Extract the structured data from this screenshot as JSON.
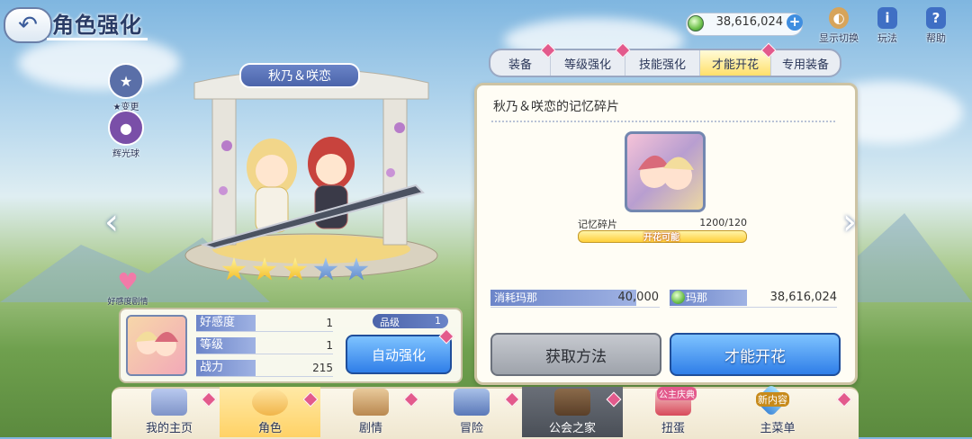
{
  "header": {
    "title": "角色强化",
    "back_icon": "back-arrow-icon",
    "mana": "38,616,024",
    "top_buttons": [
      {
        "label": "显示切换",
        "icon": "display-switch-icon"
      },
      {
        "label": "玩法",
        "icon": "info-icon"
      },
      {
        "label": "帮助",
        "icon": "help-icon"
      }
    ]
  },
  "tabs": [
    {
      "label": "装备"
    },
    {
      "label": "等级强化"
    },
    {
      "label": "技能强化"
    },
    {
      "label": "才能开花"
    },
    {
      "label": "专用装备"
    }
  ],
  "active_tab": "才能开花",
  "character": {
    "name": "秋乃＆咲恋",
    "stars_on": 3,
    "stars_total": 5,
    "side_buttons": [
      {
        "label": "★变更",
        "icon": "star-change-icon"
      },
      {
        "label": "辉光球",
        "icon": "glow-orb-icon"
      }
    ],
    "affection_label": "好感度剧情"
  },
  "stats": {
    "rows": [
      {
        "label": "好感度",
        "value": "1"
      },
      {
        "label": "等级",
        "value": "1"
      },
      {
        "label": "战力",
        "value": "215"
      }
    ],
    "rank_label": "品级",
    "rank_value": "1",
    "auto_button": "自动强化"
  },
  "panel": {
    "title": "秋乃＆咲恋的记忆碎片",
    "shard_label": "记忆碎片",
    "shard_count": "1200/120",
    "bar_text": "开花可能",
    "progress": 1.0,
    "cost_label": "消耗玛那",
    "cost_value": "40,000",
    "mana_label": "玛那",
    "mana_value": "38,616,024",
    "obtain_button": "获取方法",
    "bloom_button": "才能开花"
  },
  "nav": [
    {
      "label": "我的主页",
      "icon": "home-castle-icon"
    },
    {
      "label": "角色",
      "icon": "character-icon"
    },
    {
      "label": "剧情",
      "icon": "story-scroll-icon"
    },
    {
      "label": "冒险",
      "icon": "adventure-sword-icon"
    },
    {
      "label": "公会之家",
      "icon": "guild-door-icon"
    },
    {
      "label": "扭蛋",
      "icon": "gacha-icon",
      "badge": "公主庆典"
    },
    {
      "label": "主菜单",
      "icon": "main-menu-crystal-icon",
      "badge": "新内容"
    }
  ],
  "colors": {
    "accent_blue": "#2f7ee8",
    "notify_pink": "#e35a8c",
    "tab_active": "#ffe06a"
  }
}
